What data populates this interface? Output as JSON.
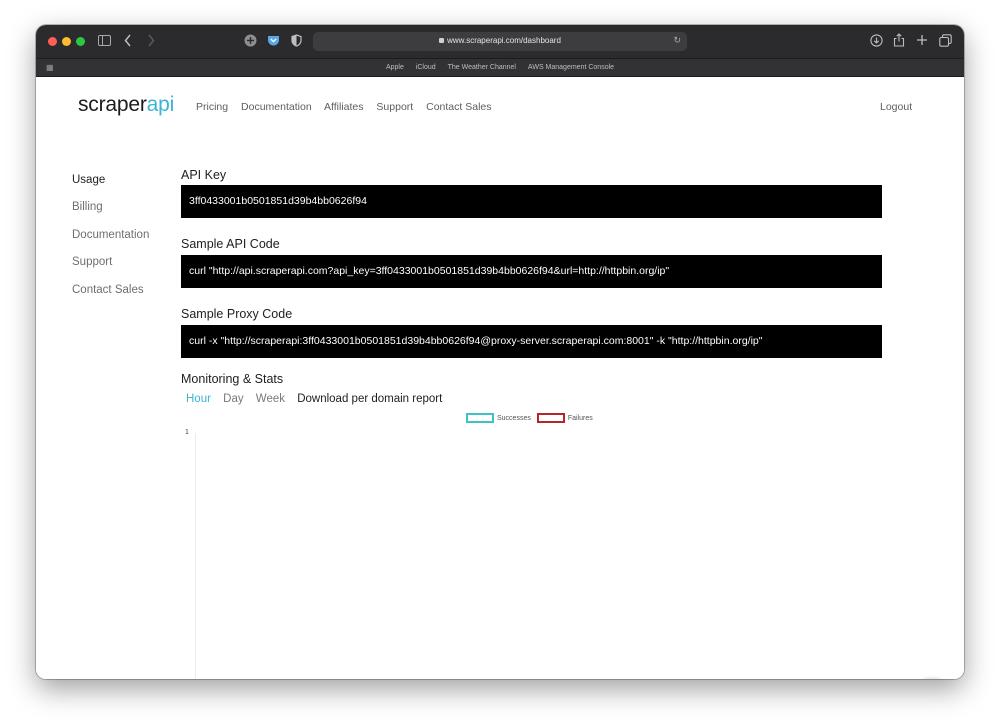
{
  "browser": {
    "url": "www.scraperapi.com/dashboard",
    "favorites": [
      "Apple",
      "iCloud",
      "The Weather Channel",
      "AWS Management Console"
    ],
    "icons": {
      "sidebar": "sidebar-toggle-icon",
      "back": "chevron-left-icon",
      "forward": "chevron-right-icon",
      "extension1": "plus-circle-icon",
      "extension2": "pocket-icon",
      "privacy": "shield-icon",
      "reload": "reload-icon",
      "download": "download-icon",
      "share": "share-icon",
      "newtab": "plus-icon",
      "tabs": "tab-overview-icon",
      "favorites_grid": "grid-icon"
    }
  },
  "header": {
    "logo_main": "scraper",
    "logo_accent": "api",
    "nav": [
      "Pricing",
      "Documentation",
      "Affiliates",
      "Support",
      "Contact Sales"
    ],
    "logout": "Logout"
  },
  "sidebar": {
    "items": [
      {
        "label": "Usage",
        "active": true
      },
      {
        "label": "Billing",
        "active": false
      },
      {
        "label": "Documentation",
        "active": false
      },
      {
        "label": "Support",
        "active": false
      },
      {
        "label": "Contact Sales",
        "active": false
      }
    ]
  },
  "main": {
    "api_key_heading": "API Key",
    "api_key": "3ff0433001b0501851d39b4bb0626f94",
    "sample_api_heading": "Sample API Code",
    "sample_api_code": "curl \"http://api.scraperapi.com?api_key=3ff0433001b0501851d39b4bb0626f94&url=http://httpbin.org/ip\"",
    "sample_proxy_heading": "Sample Proxy Code",
    "sample_proxy_code": "curl -x \"http://scraperapi:3ff0433001b0501851d39b4bb0626f94@proxy-server.scraperapi.com:8001\" -k \"http://httpbin.org/ip\"",
    "monitoring_heading": "Monitoring & Stats",
    "tabs": [
      {
        "label": "Hour",
        "active": true
      },
      {
        "label": "Day",
        "active": false
      },
      {
        "label": "Week",
        "active": false
      }
    ],
    "report_link": "Download per domain report"
  },
  "chart_data": {
    "type": "line",
    "series": [
      {
        "name": "Successes",
        "color": "#3fc1c9",
        "values": []
      },
      {
        "name": "Failures",
        "color": "#b52626",
        "values": []
      }
    ],
    "yticks": [
      "1"
    ],
    "legend_position": "top"
  },
  "colors": {
    "accent": "#38b6d8",
    "code_bg": "#000000",
    "toolbar": "#2b2b2d"
  }
}
